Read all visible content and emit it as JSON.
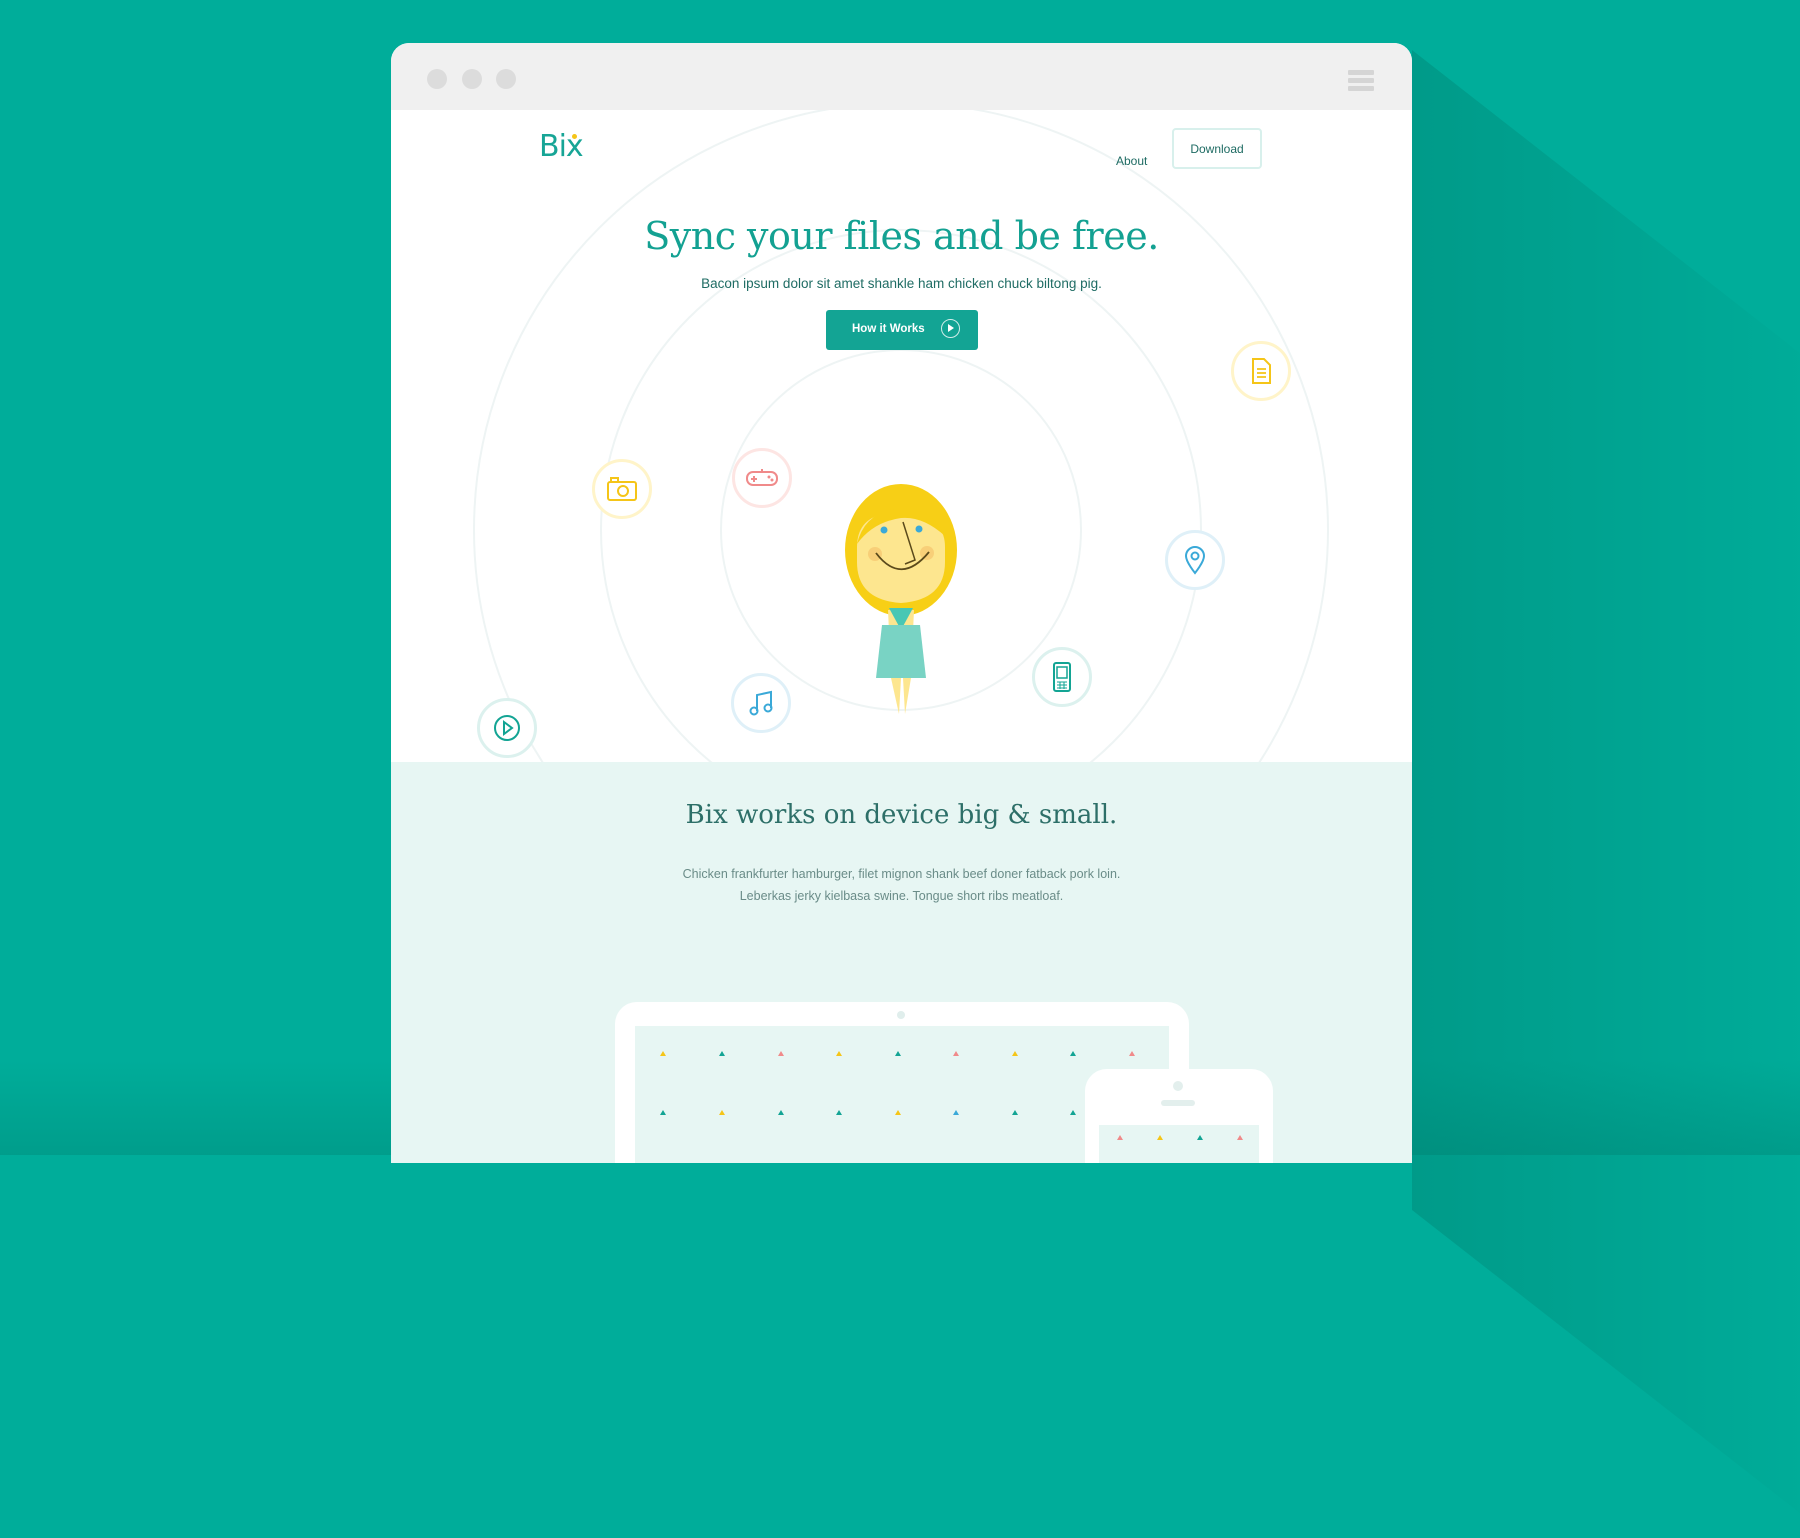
{
  "nav": {
    "logo": "Bix",
    "about": "About",
    "download": "Download"
  },
  "hero": {
    "title": "Sync your files and be free.",
    "subtitle": "Bacon ipsum dolor sit amet shankle ham chicken chuck biltong pig.",
    "cta": "How it Works"
  },
  "section": {
    "title": "Bix works on device big & small.",
    "line1": "Chicken frankfurter hamburger, filet mignon shank beef doner fatback pork loin.",
    "line2": "Leberkas jerky kielbasa swine. Tongue short ribs meatloaf."
  },
  "icons": [
    "document-icon",
    "camera-icon",
    "gamepad-icon",
    "map-pin-icon",
    "play-icon",
    "music-icon",
    "phone-icon",
    "monitor-icon"
  ],
  "colors": {
    "background": "#00ad9a",
    "accent": "#13a494",
    "yellow": "#f5c518",
    "pink": "#f08a8a",
    "blue": "#3aa9d8",
    "mint": "#e7f6f3"
  }
}
